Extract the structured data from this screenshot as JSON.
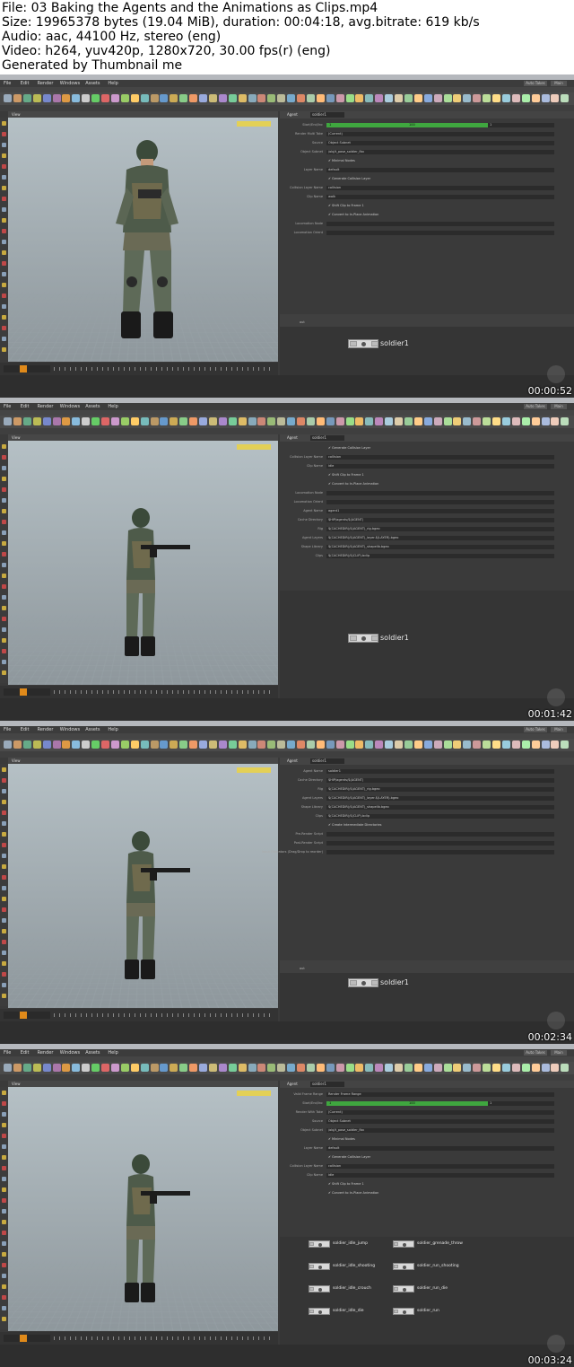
{
  "header": {
    "file": "File: 03 Baking the Agents and the Animations as Clips.mp4",
    "size": "Size: 19965378 bytes (19.04 MiB), duration: 00:04:18, avg.bitrate: 619 kb/s",
    "audio": "Audio: aac, 44100 Hz, stereo (eng)",
    "video": "Video: h264, yuv420p, 1280x720, 30.00 fps(r) (eng)",
    "generator": "Generated by Thumbnail me"
  },
  "app": {
    "menu": [
      "File",
      "Edit",
      "Render",
      "Windows",
      "Assets",
      "Help"
    ],
    "desktop": "Auto Takes",
    "desktop_mode": "Main",
    "viewport_title": "View",
    "agent_label": "Agent",
    "agent_name": "soldier1",
    "net_path": "out"
  },
  "frames": [
    {
      "timestamp": "00:00:52",
      "node_label": "soldier1",
      "params": [
        {
          "label": "Start/End/Inc",
          "type": "bar",
          "v1": "1",
          "v2": "100",
          "v3": "1"
        },
        {
          "label": "Render Multi Take",
          "value": "(Current)"
        },
        {
          "label": "Source",
          "value": "Object Subnet"
        },
        {
          "label": "Object Subnet",
          "value": "/obj/t_pose_soldier_fbx"
        },
        {
          "label": "",
          "check": "Minimal Nodes"
        },
        {
          "label": "Layer Name",
          "value": "default"
        },
        {
          "label": "",
          "check": "Generate Collision Layer"
        },
        {
          "label": "Collision Layer Name",
          "value": "collision"
        },
        {
          "label": "Clip Name",
          "value": "walk"
        },
        {
          "label": "",
          "check": "Shift Clip to Frame 1"
        },
        {
          "label": "",
          "check": "Convert to In-Place Animation"
        },
        {
          "label": "Locomotion Node",
          "value": ""
        },
        {
          "label": "Locomotion Orient",
          "value": ""
        }
      ]
    },
    {
      "timestamp": "00:01:42",
      "node_label": "soldier1",
      "params": [
        {
          "label": "",
          "check": "Generate Collision Layer"
        },
        {
          "label": "Collision Layer Name",
          "value": "collision"
        },
        {
          "label": "Clip Name",
          "value": "idle"
        },
        {
          "label": "",
          "check": "Shift Clip to Frame 1"
        },
        {
          "label": "",
          "check": "Convert to In-Place Animation"
        },
        {
          "label": "Locomotion Node",
          "value": ""
        },
        {
          "label": "Locomotion Orient",
          "value": ""
        },
        {
          "label": "Agent Name",
          "value": "agent1"
        },
        {
          "label": "Cache Directory",
          "value": "$HIP/agents/$(AGENT)"
        },
        {
          "label": "Rig",
          "value": "$(CACHEDIR)/$(AGENT)_rig.bgeo"
        },
        {
          "label": "Agent Layers",
          "value": "$(CACHEDIR)/$(AGENT)_layer.$(LAYER).bgeo"
        },
        {
          "label": "Shape Library",
          "value": "$(CACHEDIR)/$(AGENT)_shapelib.bgeo"
        },
        {
          "label": "Clips",
          "value": "$(CACHEDIR)/$(CLIP).bclip"
        }
      ]
    },
    {
      "timestamp": "00:02:34",
      "node_label": "soldier1",
      "params": [
        {
          "label": "Agent Name",
          "value": "soldier1"
        },
        {
          "label": "Cache Directory",
          "value": "$HIP/agents/$(AGENT)"
        },
        {
          "label": "Rig",
          "value": "$(CACHEDIR)/$(AGENT)_rig.bgeo"
        },
        {
          "label": "Agent Layers",
          "value": "$(CACHEDIR)/$(AGENT)_layer.$(LAYER).bgeo"
        },
        {
          "label": "Shape Library",
          "value": "$(CACHEDIR)/$(AGENT)_shapelib.bgeo"
        },
        {
          "label": "Clips",
          "value": "$(CACHEDIR)/$(CLIP).bclip"
        },
        {
          "label": "",
          "check": "Create Intermediate Directories"
        },
        {
          "label": "Pre-Render Script",
          "value": ""
        },
        {
          "label": "Post-Render Script",
          "value": ""
        },
        {
          "label": "Input Operators (Drag/Drop to reorder)",
          "value": ""
        }
      ]
    },
    {
      "timestamp": "00:03:24",
      "clips": [
        "soldier_idle_jump",
        "soldier_idle_shooting",
        "soldier_idle_crouch",
        "soldier_idle_die",
        "soldier_grenade_throw",
        "soldier_run_shooting",
        "soldier_run_die",
        "soldier_run"
      ],
      "params": [
        {
          "label": "Valid Frame Range",
          "value": "Render Frame Range"
        },
        {
          "label": "Start/End/Inc",
          "type": "bar",
          "v1": "1",
          "v2": "100",
          "v3": "1"
        },
        {
          "label": "Render With Take",
          "value": "(Current)"
        },
        {
          "label": "Source",
          "value": "Object Subnet"
        },
        {
          "label": "Object Subnet",
          "value": "/obj/t_pose_soldier_fbx"
        },
        {
          "label": "",
          "check": "Minimal Nodes"
        },
        {
          "label": "Layer Name",
          "value": "default"
        },
        {
          "label": "",
          "check": "Generate Collision Layer"
        },
        {
          "label": "Collision Layer Name",
          "value": "collision"
        },
        {
          "label": "Clip Name",
          "value": "idle"
        },
        {
          "label": "",
          "check": "Shift Clip to Frame 1"
        },
        {
          "label": "",
          "check": "Convert to In-Place Animation"
        }
      ]
    }
  ],
  "colors": {
    "accent": "#e08a1a",
    "progress": "#3fa73f",
    "viewport": "#a4afb4"
  }
}
